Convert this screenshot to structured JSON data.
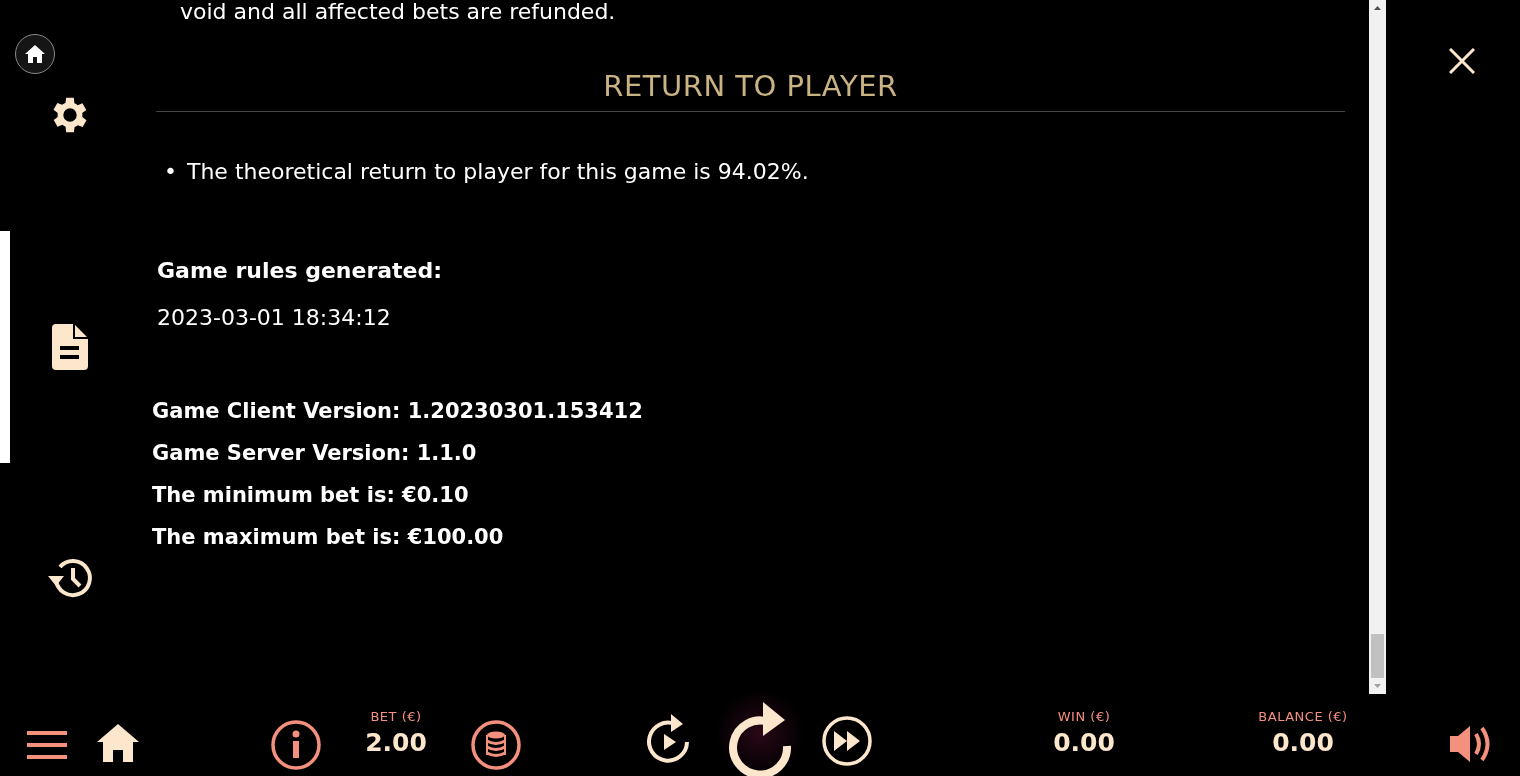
{
  "top_text": "void and all affected bets are refunded.",
  "section": {
    "title": "RETURN TO PLAYER",
    "marker": "•",
    "bullets": [
      "The theoretical return to player for this game is 94.02%."
    ]
  },
  "generated": {
    "label": "Game rules generated:",
    "value": "2023-03-01 18:34:12"
  },
  "info_lines": [
    "Game Client Version: 1.20230301.153412",
    "Game Server Version: 1.1.0",
    "The minimum bet is: €0.10",
    "The maximum bet is: €100.00"
  ],
  "sidebar": {
    "items": [
      {
        "kind": "settings",
        "selected": false
      },
      {
        "kind": "rules",
        "selected": true
      },
      {
        "kind": "history",
        "selected": false
      }
    ]
  },
  "bottom_bar": {
    "bet": {
      "label": "BET (€)",
      "value": "2.00"
    },
    "win": {
      "label": "WIN (€)",
      "value": "0.00"
    },
    "balance": {
      "label": "BALANCE (€)",
      "value": "0.00"
    }
  }
}
